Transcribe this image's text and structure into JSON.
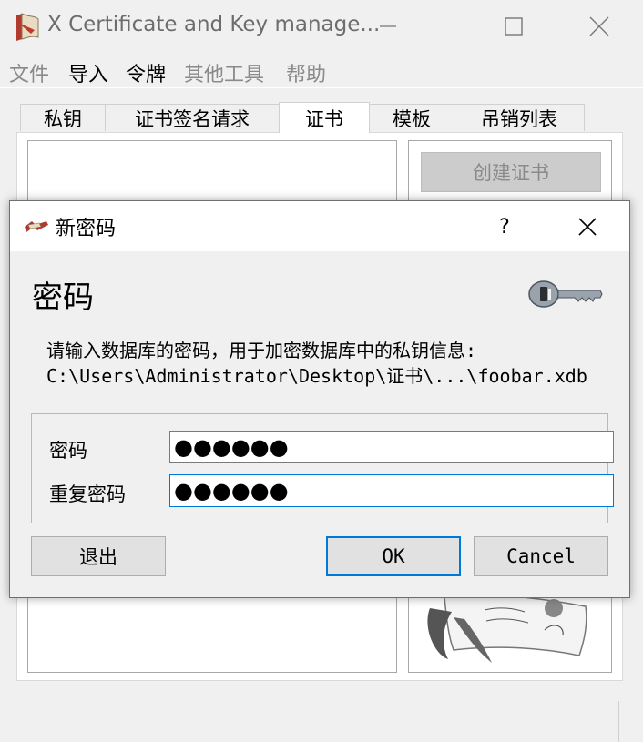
{
  "window": {
    "title": "X Certificate and Key manage...",
    "icon": "xca-app-icon"
  },
  "menu": {
    "items": [
      {
        "label": "文件",
        "enabled": false
      },
      {
        "label": "导入",
        "enabled": true
      },
      {
        "label": "令牌",
        "enabled": true
      },
      {
        "label": "其他工具",
        "enabled": false
      },
      {
        "label": "帮助",
        "enabled": false
      }
    ]
  },
  "tabs": [
    {
      "label": "私钥",
      "active": false
    },
    {
      "label": "证书签名请求",
      "active": false
    },
    {
      "label": "证书",
      "active": true
    },
    {
      "label": "模板",
      "active": false
    },
    {
      "label": "吊销列表",
      "active": false
    }
  ],
  "side": {
    "create_button": "创建证书"
  },
  "dialog": {
    "title": "新密码",
    "help": "?",
    "heading": "密码",
    "description_line1": "请输入数据库的密码，用于加密数据库中的私钥信息:",
    "description_line2": "C:\\Users\\Administrator\\Desktop\\证书\\...\\foobar.xdb",
    "fields": {
      "password_label": "密码",
      "password_value": "●●●●●●",
      "repeat_label": "重复密码",
      "repeat_value": "●●●●●●"
    },
    "buttons": {
      "exit": "退出",
      "ok": "OK",
      "cancel": "Cancel"
    }
  },
  "colors": {
    "accent": "#0078d7",
    "window_bg": "#f0f0f0",
    "disabled_text": "#8a8a8a"
  }
}
